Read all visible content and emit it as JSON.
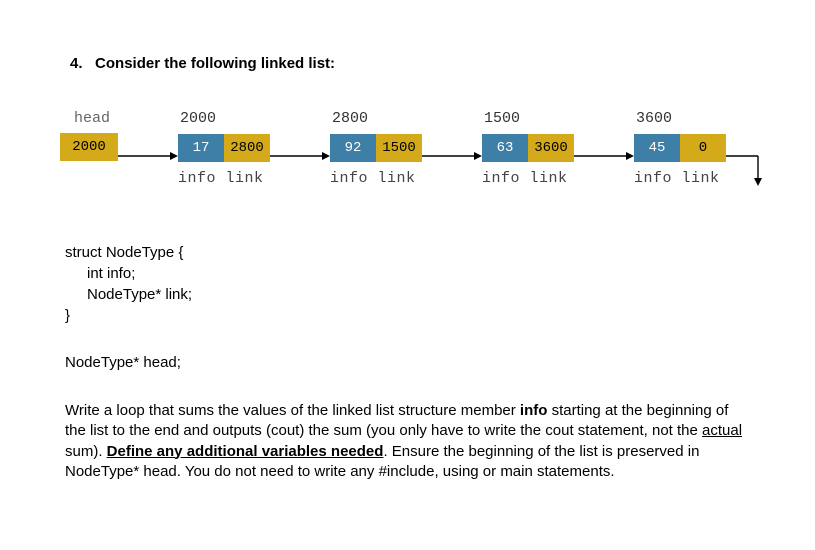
{
  "question": {
    "number": "4.",
    "heading": "Consider the following linked list:"
  },
  "diagram": {
    "head_label": "head",
    "head_value": "2000",
    "info_label": "info",
    "link_label": "link",
    "nodes": [
      {
        "address": "2000",
        "info": "17",
        "link": "2800"
      },
      {
        "address": "2800",
        "info": "92",
        "link": "1500"
      },
      {
        "address": "1500",
        "info": "63",
        "link": "3600"
      },
      {
        "address": "3600",
        "info": "45",
        "link": "0"
      }
    ]
  },
  "struct_def": {
    "line1": "struct NodeType {",
    "line2": "int info;",
    "line3": "NodeType* link;",
    "line4": "}"
  },
  "head_decl": "NodeType* head;",
  "prompt": {
    "text1": "Write a loop that sums the values of the linked list structure member ",
    "bold1": "info",
    "text2": " starting at the beginning of the list to the end and outputs (cout) the sum (you only have to write the cout statement, not the ",
    "under1": "actual",
    "text3": " sum).  ",
    "boldunder": "Define any additional variables needed",
    "text4": ".  Ensure the beginning of the list is preserved in NodeType* head.  You do not need to write any #include, using or main statements."
  },
  "chart_data": {
    "type": "table",
    "title": "Linked list node contents",
    "columns": [
      "address",
      "info",
      "link"
    ],
    "rows": [
      [
        "2000",
        17,
        "2800"
      ],
      [
        "2800",
        92,
        "1500"
      ],
      [
        "1500",
        63,
        "3600"
      ],
      [
        "3600",
        45,
        "0"
      ]
    ],
    "head_pointer": "2000"
  }
}
